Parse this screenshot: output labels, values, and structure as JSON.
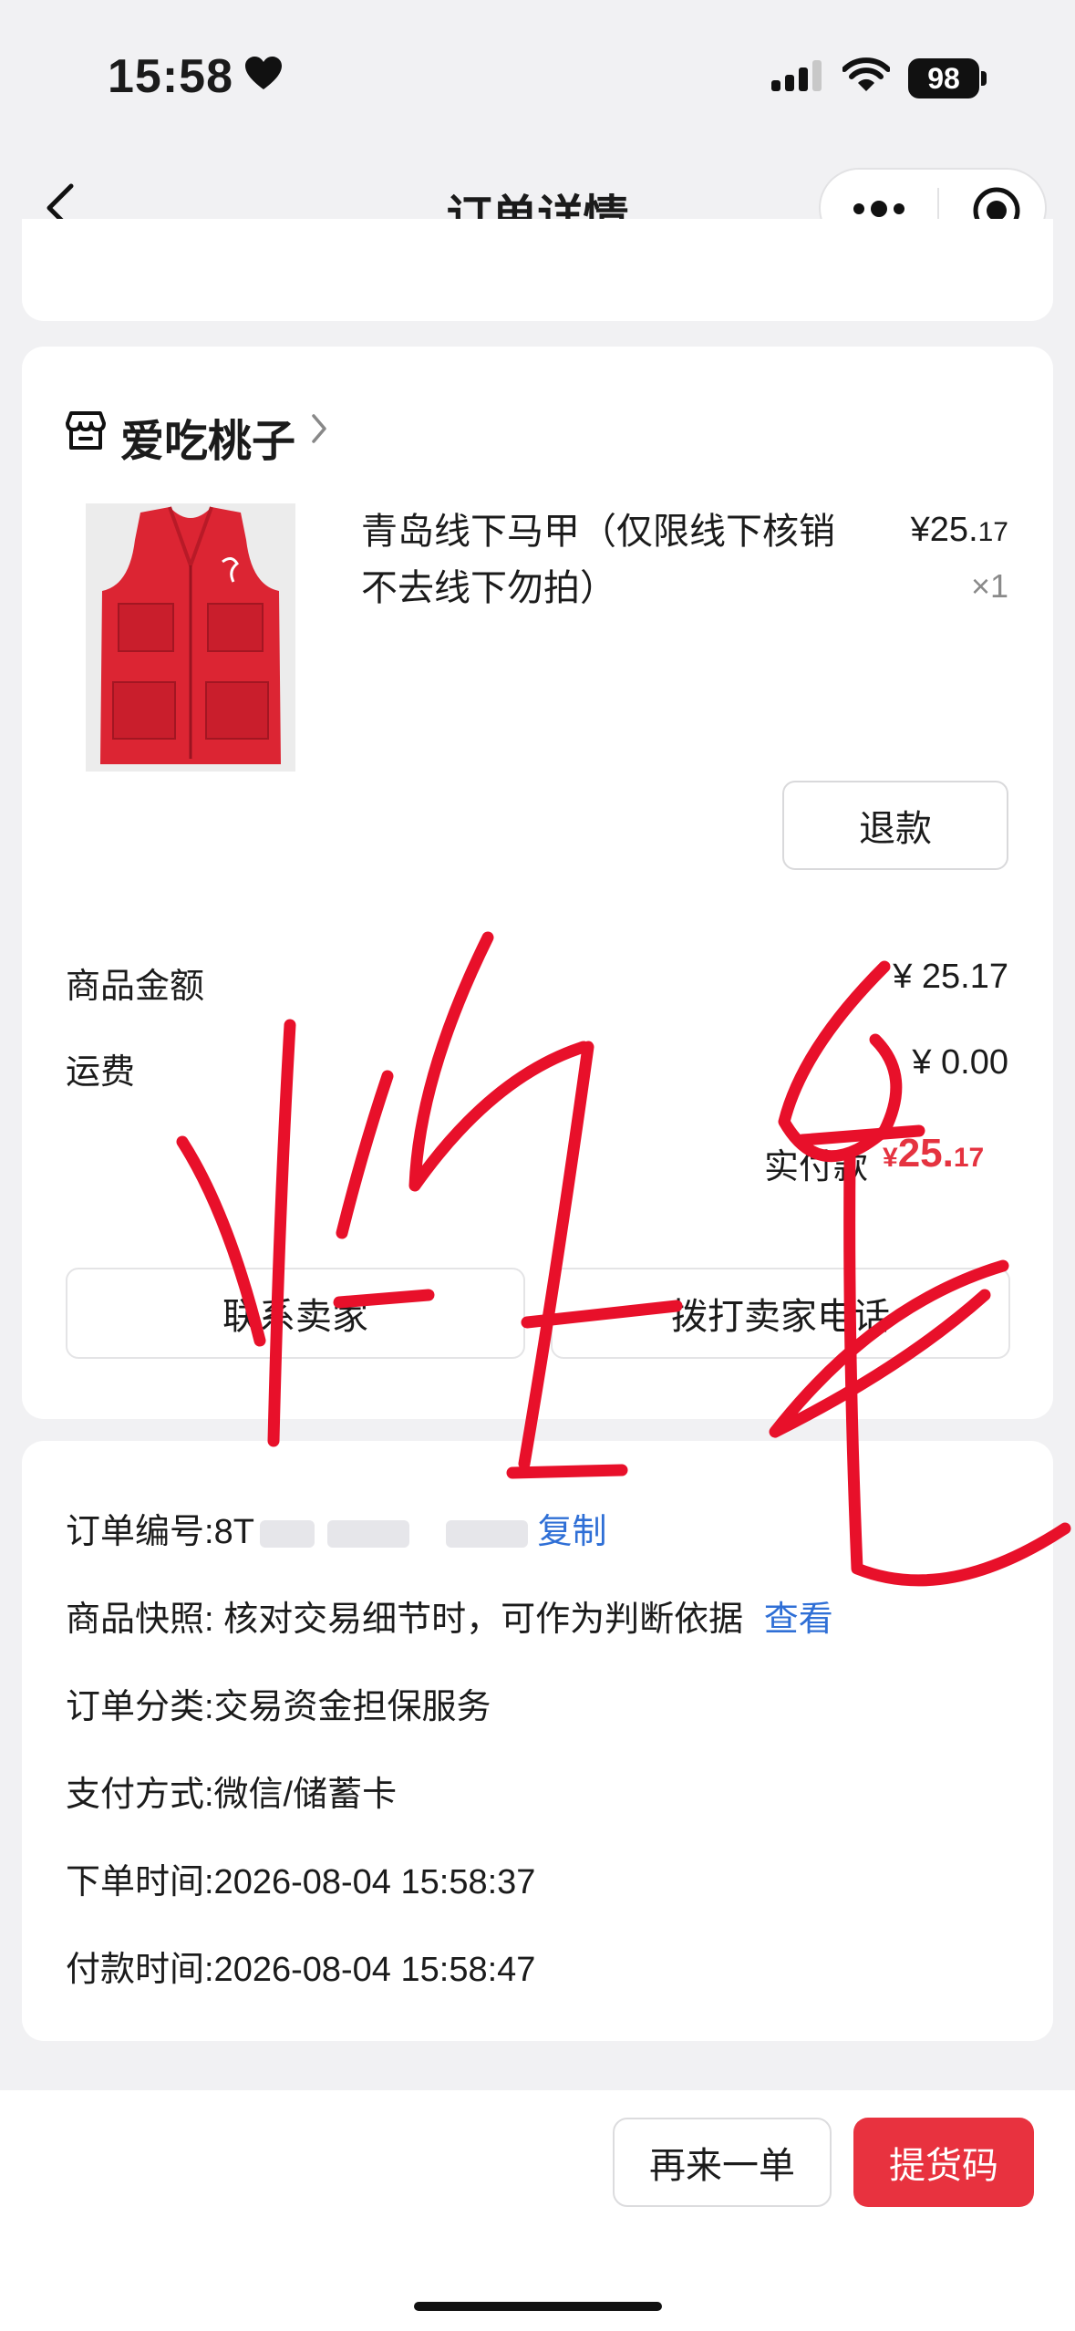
{
  "status_bar": {
    "time": "15:58",
    "battery": "98"
  },
  "nav": {
    "title": "订单详情"
  },
  "shop": {
    "name": "爱吃桃子"
  },
  "product": {
    "title": "青岛线下马甲（仅限线下核销 不去线下勿拍）",
    "price_symbol": "¥",
    "price_int": "25.",
    "price_dec": "17",
    "quantity": "×1",
    "refund_label": "退款"
  },
  "summary": {
    "goods_label": "商品金额",
    "goods_value": "¥ 25.17",
    "shipping_label": "运费",
    "shipping_value": "¥ 0.00",
    "paid_label": "实付款",
    "paid_symbol": "¥",
    "paid_int": "25.",
    "paid_dec": "17"
  },
  "actions": {
    "contact": "联系卖家",
    "call": "拨打卖家电话"
  },
  "info": {
    "order_no_label": "订单编号:",
    "order_no_partial": "8T",
    "copy_label": "复制",
    "snapshot_label": "商品快照: 核对交易细节时，可作为判断依据",
    "snapshot_link": "查看",
    "category": "订单分类:交易资金担保服务",
    "payment": "支付方式:微信/储蓄卡",
    "order_time": "下单时间:2026-08-04 15:58:37",
    "pay_time": "付款时间:2026-08-04 15:58:47"
  },
  "bottom": {
    "again": "再来一单",
    "pickup": "提货码"
  },
  "colors": {
    "accent_red": "#e8323f",
    "link_blue": "#2f6fd6",
    "scribble_red": "#e8102a"
  },
  "icons": [
    "heart-icon",
    "signal-icon",
    "wifi-icon",
    "back-icon",
    "more-icon",
    "target-icon",
    "shop-icon",
    "chevron-right-icon"
  ]
}
